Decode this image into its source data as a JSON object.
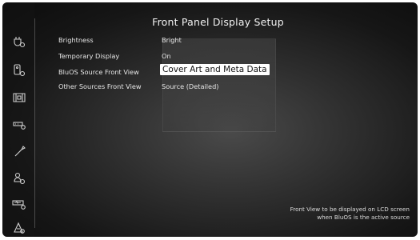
{
  "header": {
    "title": "Front Panel Display Setup"
  },
  "settings": [
    {
      "label": "Brightness",
      "value": "Bright"
    },
    {
      "label": "Temporary Display",
      "value": "On"
    },
    {
      "label": "BluOS Source Front View",
      "value": "Cover Art and Meta Data"
    },
    {
      "label": "Other Sources Front View",
      "value": "Source (Detailed)"
    }
  ],
  "help": {
    "line1": "Front View to be displayed on LCD screen",
    "line2": "when BluOS is the active source"
  },
  "sidebar": {
    "icons": [
      "input-settings-icon",
      "remote-settings-icon",
      "display-settings-icon",
      "network-settings-icon",
      "tools-icon",
      "user-settings-icon",
      "diagnostics-icon",
      "speaker-settings-icon"
    ]
  }
}
